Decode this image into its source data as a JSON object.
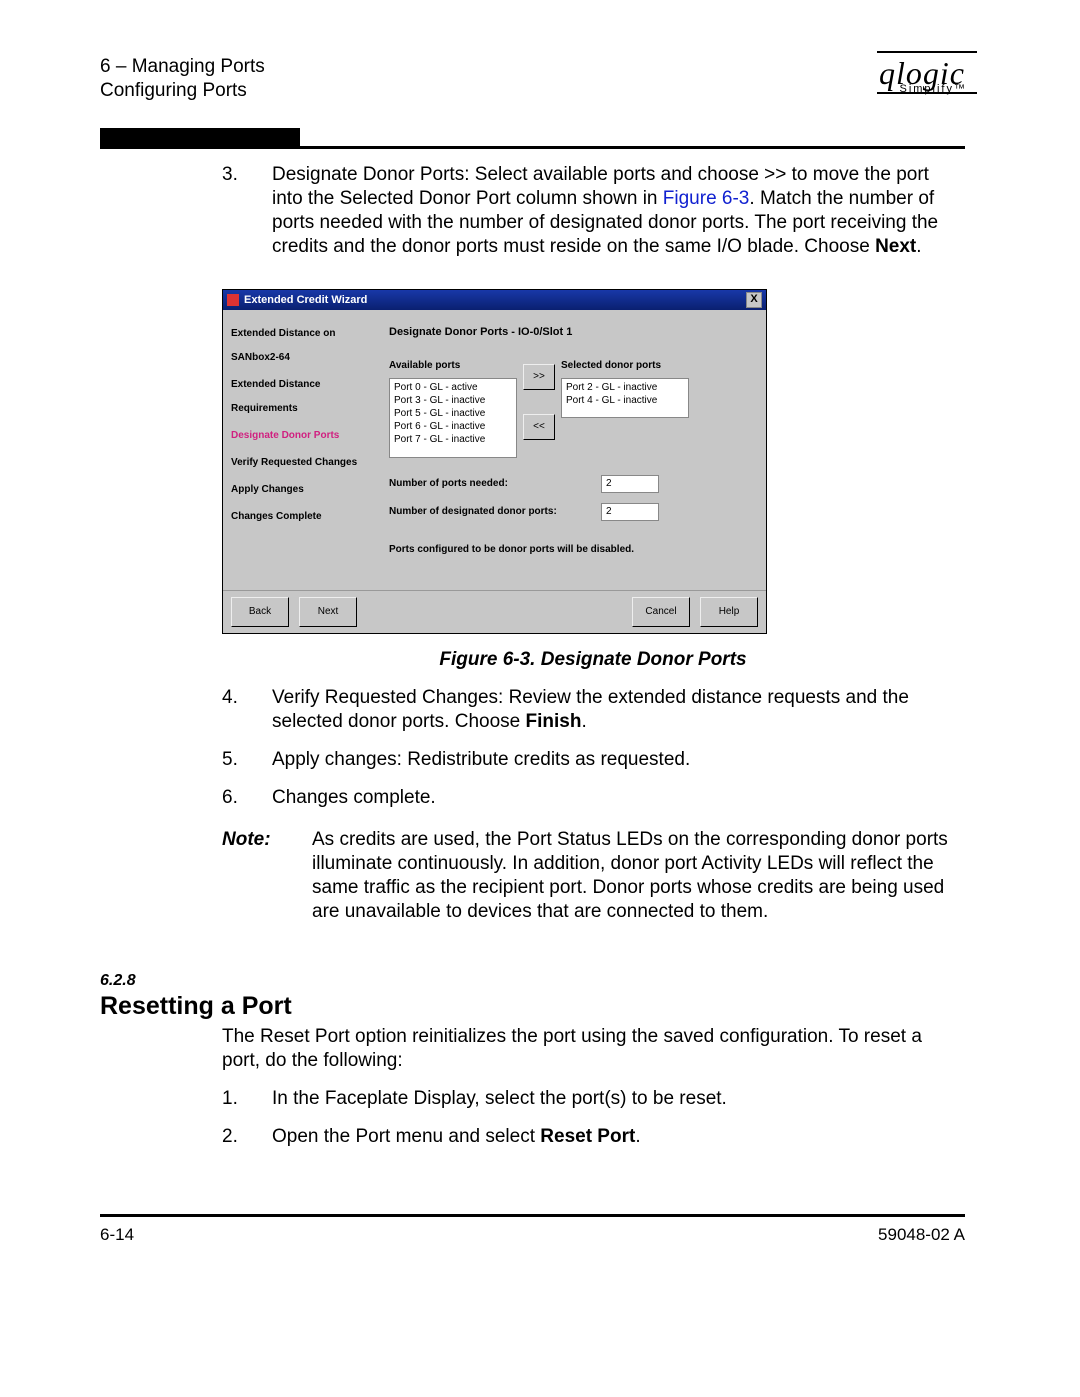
{
  "header": {
    "chapter_line": "6 – Managing Ports",
    "section_line": "Configuring Ports",
    "logo_text": "qlogic",
    "logo_sub": "Simplify™"
  },
  "step3": {
    "num": "3.",
    "text_a": "Designate Donor Ports: Select available ports and choose >> to move the port into the Selected Donor Port column shown in ",
    "link": "Figure 6-3",
    "text_b": ". Match the number of ports needed with the number of designated donor ports. The port receiving the credits and the donor ports must reside on the same I/O blade. Choose ",
    "bold": "Next",
    "text_c": "."
  },
  "wizard": {
    "title": "Extended Credit Wizard",
    "side_items": [
      {
        "label": "Extended Distance on SANbox2-64",
        "active": false
      },
      {
        "label": "Extended Distance Requirements",
        "active": false
      },
      {
        "label": "Designate Donor Ports",
        "active": true
      },
      {
        "label": "Verify Requested Changes",
        "active": false
      },
      {
        "label": "Apply Changes",
        "active": false
      },
      {
        "label": "Changes Complete",
        "active": false
      }
    ],
    "main_title": "Designate Donor Ports - IO-0/Slot 1",
    "available_title": "Available ports",
    "selected_title": "Selected donor ports",
    "available": [
      "Port 0 - GL - active",
      "Port 3 - GL - inactive",
      "Port 5 - GL - inactive",
      "Port 6 - GL - inactive",
      "Port 7 - GL - inactive"
    ],
    "selected": [
      "Port 2 - GL - inactive",
      "Port 4 - GL - inactive"
    ],
    "move_right": ">>",
    "move_left": "<<",
    "needed_label": "Number of ports needed:",
    "needed_value": "2",
    "designated_label": "Number of designated donor ports:",
    "designated_value": "2",
    "warning": "Ports configured to be donor ports will be disabled.",
    "btn_back": "Back",
    "btn_next": "Next",
    "btn_cancel": "Cancel",
    "btn_help": "Help"
  },
  "caption": "Figure 6-3.  Designate Donor Ports",
  "step4": {
    "num": "4.",
    "text_a": "Verify Requested Changes: Review the extended distance requests and the selected donor ports. Choose ",
    "bold": "Finish",
    "text_b": "."
  },
  "step5": {
    "num": "5.",
    "text": "Apply changes: Redistribute credits as requested."
  },
  "step6": {
    "num": "6.",
    "text": "Changes complete."
  },
  "note": {
    "label": "Note:",
    "text": "As credits are used, the Port Status LEDs on the corresponding donor ports illuminate continuously. In addition, donor port Activity LEDs will reflect the same traffic as the recipient port. Donor ports whose credits are being used are unavailable to devices that are connected to them."
  },
  "section": {
    "num": "6.2.8",
    "title": "Resetting a Port"
  },
  "reset_intro": "The Reset Port option reinitializes the port using the saved configuration. To reset a port, do the following:",
  "reset1": {
    "num": "1.",
    "text": "In the Faceplate Display, select the port(s) to be reset."
  },
  "reset2": {
    "num": "2.",
    "text_a": "Open the Port menu and select ",
    "bold": "Reset Port",
    "text_b": "."
  },
  "footer": {
    "left": "6-14",
    "right": "59048-02  A"
  }
}
